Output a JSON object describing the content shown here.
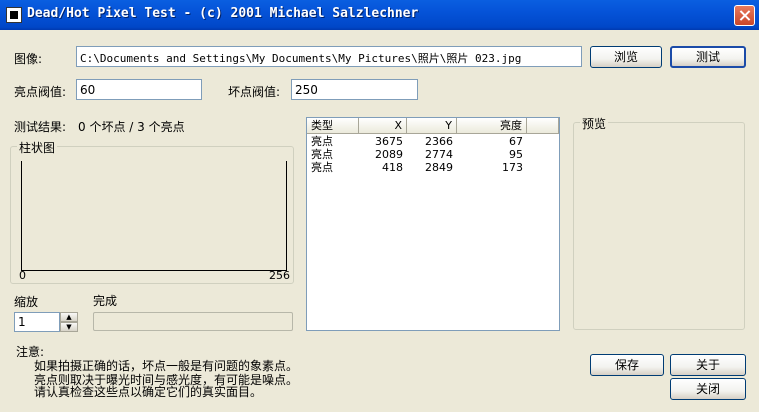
{
  "window": {
    "title": "Dead/Hot Pixel Test - (c) 2001 Michael Salzlechner"
  },
  "image_row": {
    "label": "图像:",
    "path": "C:\\Documents and Settings\\My Documents\\My Pictures\\照片\\照片 023.jpg",
    "browse_label": "浏览",
    "test_label": "测试"
  },
  "thresholds": {
    "hot_label": "亮点阀值:",
    "hot_value": "60",
    "dead_label": "坏点阀值:",
    "dead_value": "250"
  },
  "results": {
    "label": "测试结果:",
    "summary": "0 个坏点 / 3 个亮点"
  },
  "histogram": {
    "title": "柱状图",
    "x_min": "0",
    "x_max": "256"
  },
  "zoom": {
    "label": "缩放",
    "value": "1"
  },
  "progress": {
    "label": "完成",
    "percent": 0
  },
  "table": {
    "headers": [
      "类型",
      "X",
      "Y",
      "亮度"
    ],
    "rows": [
      [
        "亮点",
        "3675",
        "2366",
        "67"
      ],
      [
        "亮点",
        "2089",
        "2774",
        "95"
      ],
      [
        "亮点",
        "418",
        "2849",
        "173"
      ]
    ]
  },
  "preview": {
    "title": "预览"
  },
  "note": {
    "label": "注意:",
    "lines": [
      "如果拍摄正确的话，坏点一般是有问题的象素点。",
      "亮点则取决于曝光时间与感光度，有可能是噪点。",
      "请认真检查这些点以确定它们的真实面目。"
    ]
  },
  "buttons": {
    "save": "保存",
    "about": "关于",
    "close": "关闭"
  }
}
